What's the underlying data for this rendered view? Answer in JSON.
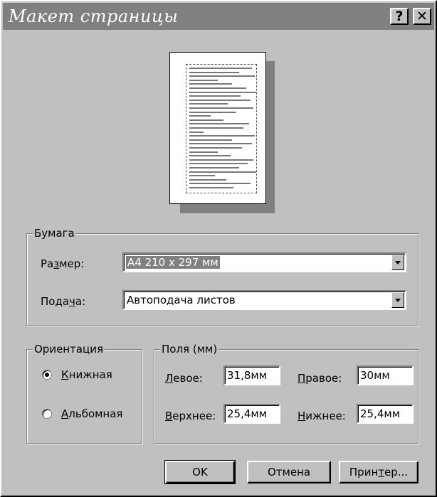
{
  "window": {
    "title": "Макет страницы",
    "help_label": "?",
    "close_label": "✕"
  },
  "paper": {
    "group_label": "Бумага",
    "size_label": "Размер:",
    "size_value": "A4 210 x 297 мм",
    "source_label": "Подача:",
    "source_value": "Автоподача листов"
  },
  "orientation": {
    "group_label": "Ориентация",
    "portrait_label": "Книжная",
    "landscape_label": "Альбомная",
    "selected": "portrait"
  },
  "margins": {
    "group_label": "Поля (мм)",
    "left_label": "Левое:",
    "left_value": "31,8мм",
    "right_label": "Правое:",
    "right_value": "30мм",
    "top_label": "Верхнее:",
    "top_value": "25,4мм",
    "bottom_label": "Нижнее:",
    "bottom_value": "25,4мм"
  },
  "buttons": {
    "ok": "OK",
    "cancel": "Отмена",
    "printer": "Принтер..."
  }
}
